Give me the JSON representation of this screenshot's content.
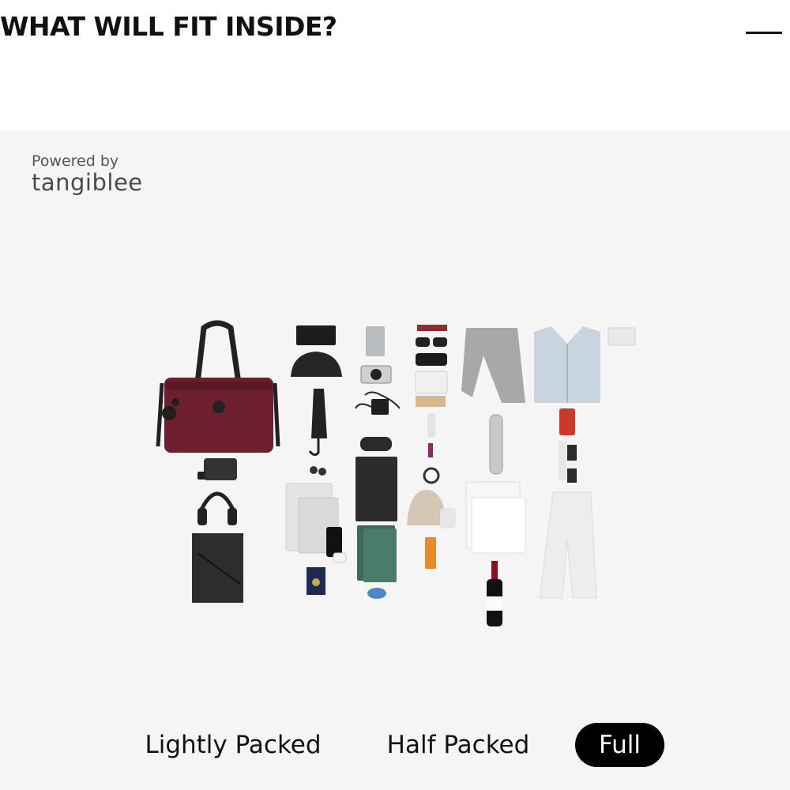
{
  "header": {
    "title": "WHAT WILL FIT INSIDE?",
    "collapse_icon": "minus-icon"
  },
  "attribution": {
    "prefix": "Powered by",
    "brand": "tangiblee"
  },
  "flatlay": {
    "items": [
      "tote-bag-icon",
      "pouch-icon",
      "headphones-icon",
      "folder-icon",
      "wallet-icon",
      "cosmetic-bag-icon",
      "umbrella-icon",
      "keys-icon",
      "tablet-icon",
      "phone-icon",
      "passport-icon",
      "power-bank-icon",
      "camera-icon",
      "charger-icon",
      "glasses-case-icon",
      "notebook-icon",
      "earbuds-case-icon",
      "sunglasses-icon",
      "wipes-icon",
      "comb-icon",
      "lipstick-icon",
      "mirror-icon",
      "beanie-icon",
      "gloves-icon",
      "sunscreen-icon",
      "scarf-icon",
      "water-bottle-icon",
      "t-shirt-icon",
      "wine-bottle-icon",
      "cardigan-icon",
      "mug-icon",
      "socks-icon",
      "trousers-icon",
      "tissues-icon"
    ]
  },
  "pack_options": {
    "items": [
      "Lightly Packed",
      "Half Packed",
      "Full"
    ],
    "selected": "Full"
  },
  "colors": {
    "panel_background": "#f5f5f5",
    "selected_pill": "#000000",
    "bag": "#6e1f2e"
  }
}
